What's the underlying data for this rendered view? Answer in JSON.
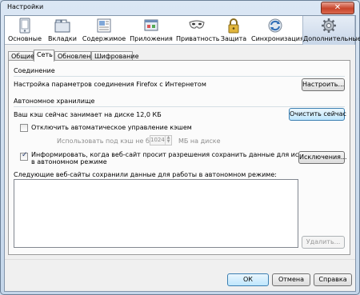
{
  "window": {
    "title": "Настройки",
    "close_glyph": "✕"
  },
  "toolbar": {
    "items": [
      {
        "label": "Основные",
        "icon": "general-icon"
      },
      {
        "label": "Вкладки",
        "icon": "tabs-icon"
      },
      {
        "label": "Содержимое",
        "icon": "content-icon"
      },
      {
        "label": "Приложения",
        "icon": "applications-icon"
      },
      {
        "label": "Приватность",
        "icon": "privacy-mask-icon"
      },
      {
        "label": "Защита",
        "icon": "security-lock-icon"
      },
      {
        "label": "Синхронизация",
        "icon": "sync-icon"
      },
      {
        "label": "Дополнительные",
        "icon": "advanced-gear-icon",
        "selected": true
      }
    ]
  },
  "tabs": [
    {
      "label": "Общие"
    },
    {
      "label": "Сеть",
      "active": true
    },
    {
      "label": "Обновления"
    },
    {
      "label": "Шифрование"
    }
  ],
  "connection": {
    "title": "Соединение",
    "description": "Настройка параметров соединения Firefox с Интернетом",
    "settings_button": "Настроить..."
  },
  "offline": {
    "title": "Автономное хранилище",
    "cache_usage": "Ваш кэш сейчас занимает на диске 12,0 КБ",
    "clear_button": "Очистить сейчас",
    "override_cache_label": "Отключить автоматическое управление кэшем",
    "override_cache_checked": false,
    "limit_prefix": "Использовать под кэш не более",
    "limit_value": "1024",
    "limit_suffix": "МБ на диске",
    "notify_label_line1": "Информировать, когда веб-сайт просит разрешения сохранить данные для использования",
    "notify_label_line2": "в автономном режиме",
    "notify_checked": true,
    "exceptions_button": "Исключения...",
    "sites_label": "Следующие веб-сайты сохранили данные для работы в автономном режиме:",
    "sites": [],
    "remove_button": "Удалить..."
  },
  "footer": {
    "ok": "ОК",
    "cancel": "Отмена",
    "help": "Справка"
  },
  "colors": {
    "selected_toolbar": "#c8d6e8",
    "window_frame": "#c4d6ea",
    "close_button": "#c8442a"
  }
}
